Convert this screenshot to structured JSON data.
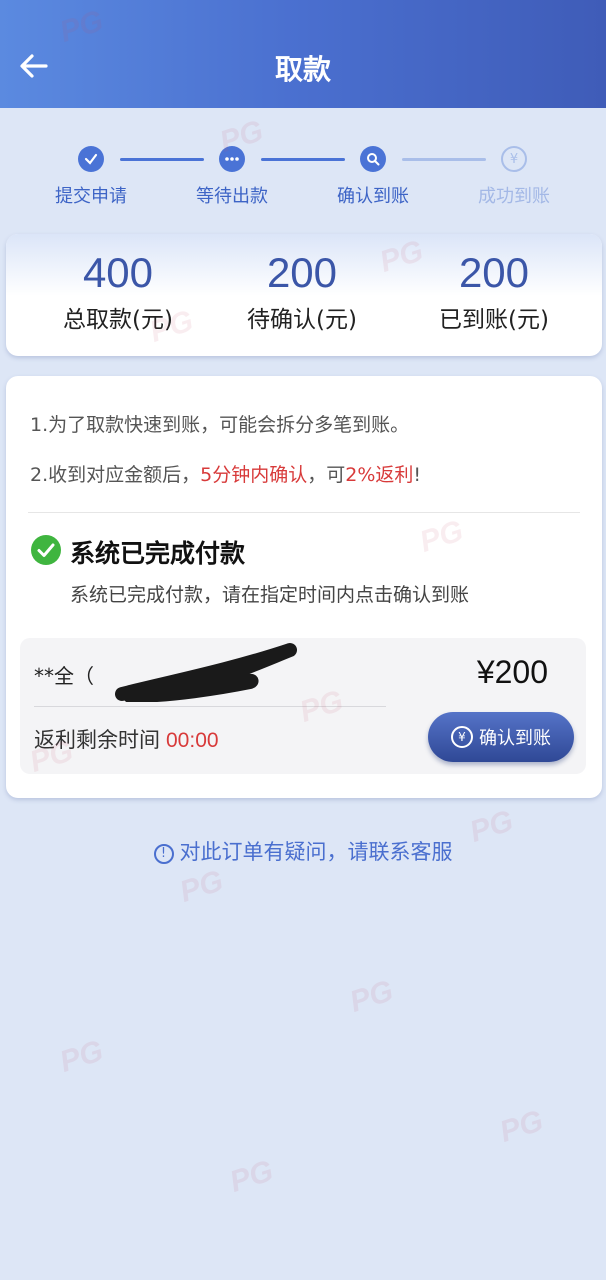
{
  "header": {
    "title": "取款"
  },
  "steps": [
    {
      "label": "提交申请",
      "status": "done",
      "icon": "check-icon"
    },
    {
      "label": "等待出款",
      "status": "done",
      "icon": "dots-icon"
    },
    {
      "label": "确认到账",
      "status": "done",
      "icon": "search-icon"
    },
    {
      "label": "成功到账",
      "status": "todo",
      "icon": "yen-icon"
    }
  ],
  "stats": [
    {
      "value": "400",
      "label": "总取款(元)"
    },
    {
      "value": "200",
      "label": "待确认(元)"
    },
    {
      "value": "200",
      "label": "已到账(元)"
    }
  ],
  "notes": {
    "line1": "1.为了取款快速到账，可能会拆分多笔到账。",
    "line2_a": "2.收到对应金额后，",
    "line2_red1": "5分钟内确认",
    "line2_b": "，可",
    "line2_red2": "2%返利",
    "line2_c": "!"
  },
  "status": {
    "title": "系统已完成付款",
    "desc": "系统已完成付款，请在指定时间内点击确认到账"
  },
  "order": {
    "payee": "**全（",
    "amount": "¥200",
    "rebate_label": "返利剩余时间",
    "rebate_time": "00:00",
    "confirm_label": "确认到账",
    "confirm_icon_glyph": "¥"
  },
  "help": {
    "icon_glyph": "!",
    "text": "对此订单有疑问，请联系客服"
  },
  "watermark": {
    "text": "PG"
  },
  "colors": {
    "accent": "#4a73d6",
    "red": "#d83a3a",
    "success": "#3fb53f"
  }
}
